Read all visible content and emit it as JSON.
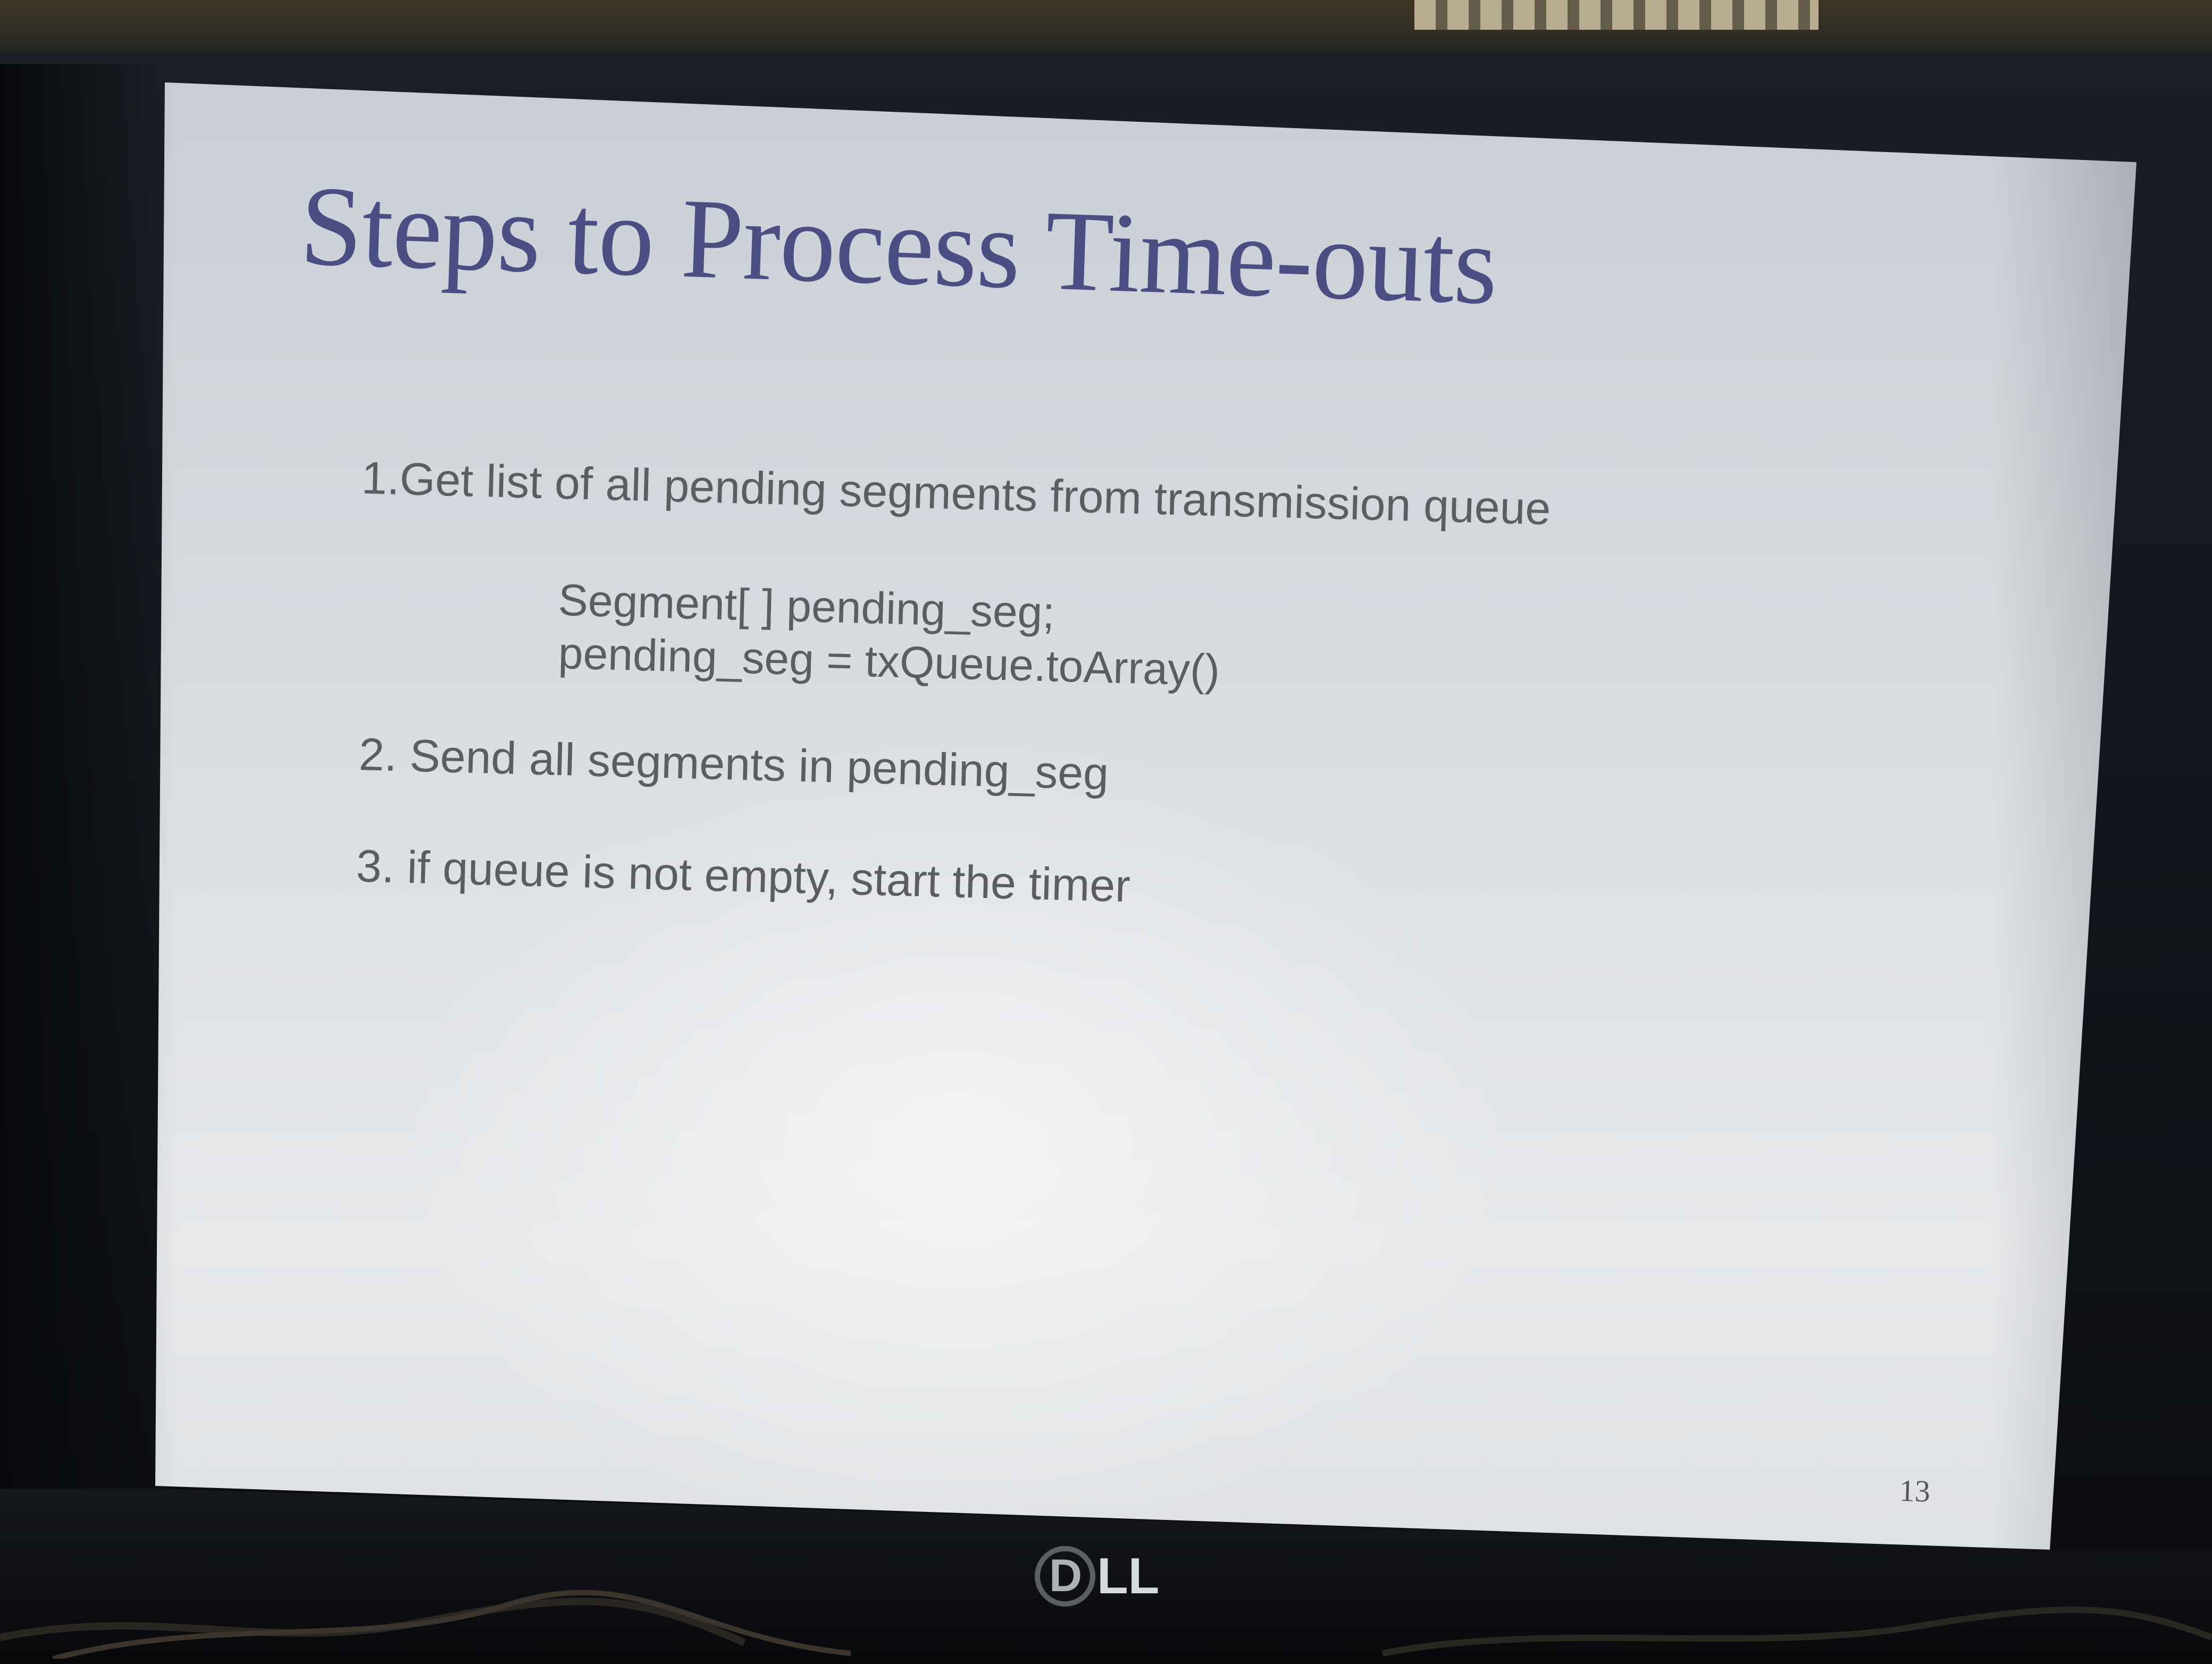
{
  "slide": {
    "title": "Steps to Process Time-outs",
    "steps": [
      "1.Get list of all pending segments from transmission queue",
      "2. Send all segments in pending_seg",
      "3. if queue is not empty, start the timer"
    ],
    "code_lines": [
      "Segment[ ] pending_seg;",
      "pending_seg = txQueue.toArray()"
    ],
    "page_number": "13"
  },
  "monitor": {
    "brand_logo_text": "DELL"
  },
  "colors": {
    "title": "#4a4e83",
    "body_text": "#5b5d63",
    "screen_background": "#dfe2e5",
    "bezel": "#12161c"
  }
}
